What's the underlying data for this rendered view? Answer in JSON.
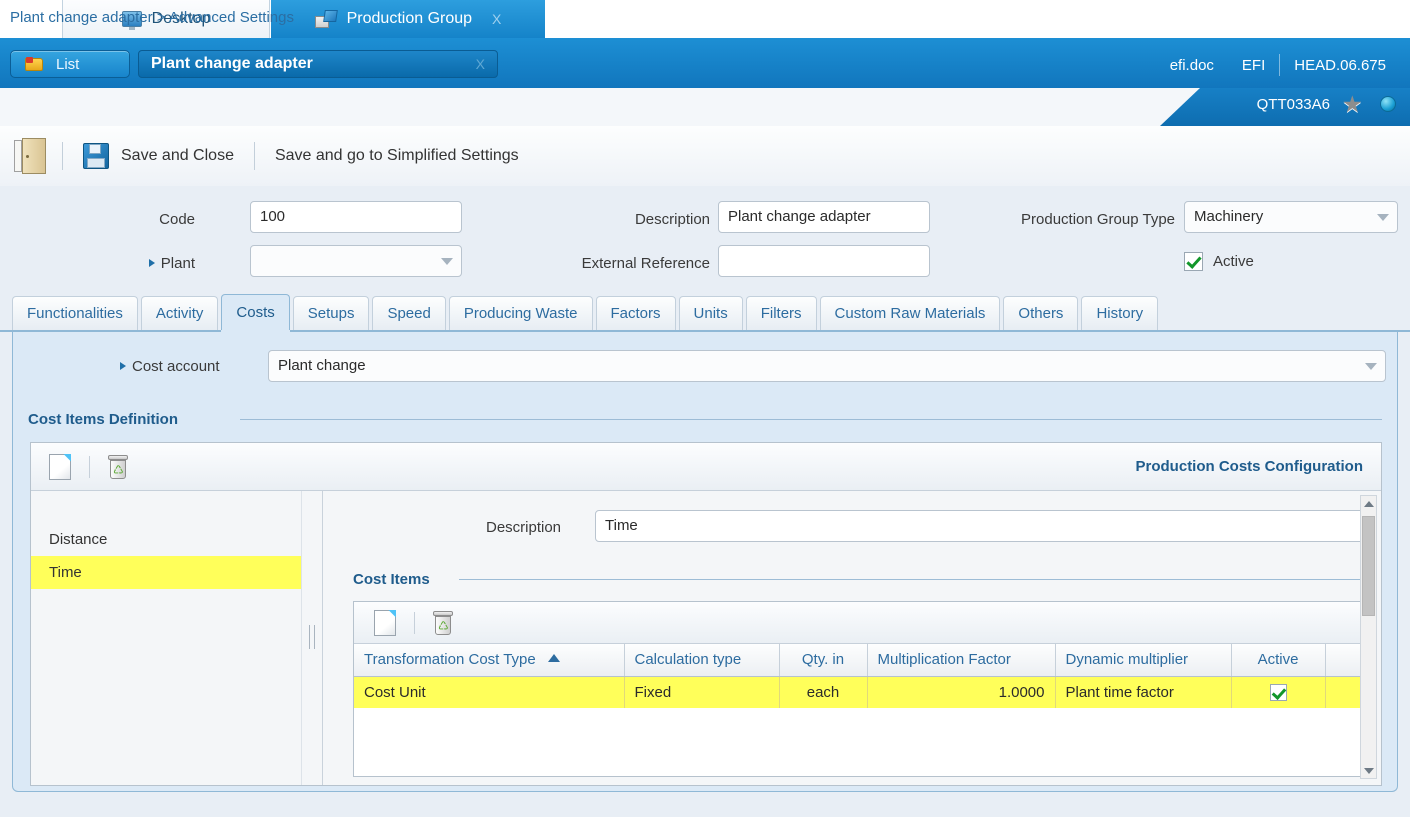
{
  "browser_tabs": [
    {
      "label": "Desktop",
      "icon": "monitor-icon",
      "active": false,
      "close": ""
    },
    {
      "label": "Production Group",
      "icon": "production-group-icon",
      "active": true,
      "close": "X"
    }
  ],
  "header": {
    "list_button": "List",
    "document_title": "Plant change adapter",
    "document_close": "X",
    "user": "efi.doc",
    "company": "EFI",
    "version": "HEAD.06.675",
    "session_code": "QTT033A6",
    "star_icon": "star-icon",
    "globe_icon": "globe-icon"
  },
  "breadcrumb": "Plant change adapter > Advanced Settings",
  "toolbar": {
    "exit_icon": "exit-door-icon",
    "save_and_close": "Save and Close",
    "save_and_simplified": "Save and go to Simplified Settings"
  },
  "form": {
    "code_label": "Code",
    "code_value": "100",
    "plant_label": "Plant",
    "plant_value": "",
    "description_label": "Description",
    "description_value": "Plant change adapter",
    "external_reference_label": "External Reference",
    "external_reference_value": "",
    "production_group_type_label": "Production Group Type",
    "production_group_type_value": "Machinery",
    "active_label": "Active",
    "active_checked": true
  },
  "tabs": [
    {
      "label": "Functionalities",
      "active": false
    },
    {
      "label": "Activity",
      "active": false
    },
    {
      "label": "Costs",
      "active": true
    },
    {
      "label": "Setups",
      "active": false
    },
    {
      "label": "Speed",
      "active": false
    },
    {
      "label": "Producing Waste",
      "active": false
    },
    {
      "label": "Factors",
      "active": false
    },
    {
      "label": "Units",
      "active": false
    },
    {
      "label": "Filters",
      "active": false
    },
    {
      "label": "Custom Raw Materials",
      "active": false
    },
    {
      "label": "Others",
      "active": false
    },
    {
      "label": "History",
      "active": false
    }
  ],
  "costs_tab": {
    "cost_account_label": "Cost account",
    "cost_account_value": "Plant change",
    "cost_items_definition_title": "Cost Items Definition",
    "card_toolbar": {
      "new_icon": "new-document-icon",
      "delete_icon": "delete-trash-icon",
      "config_link": "Production Costs Configuration"
    },
    "definition_list": [
      {
        "label": "Distance",
        "selected": false
      },
      {
        "label": "Time",
        "selected": true
      }
    ],
    "detail": {
      "description_label": "Description",
      "description_value": "Time",
      "cost_items_title": "Cost Items",
      "grid_toolbar": {
        "new_icon": "new-document-icon",
        "delete_icon": "delete-trash-icon"
      },
      "grid": {
        "columns": [
          {
            "label": "Transformation Cost Type",
            "sort": "asc",
            "align": "left"
          },
          {
            "label": "Calculation type",
            "sort": "",
            "align": "left"
          },
          {
            "label": "Qty. in",
            "sort": "",
            "align": "center"
          },
          {
            "label": "Multiplication Factor",
            "sort": "",
            "align": "right"
          },
          {
            "label": "Dynamic multiplier",
            "sort": "",
            "align": "left"
          },
          {
            "label": "Active",
            "sort": "",
            "align": "center"
          }
        ],
        "rows": [
          {
            "transformation_cost_type": "Cost Unit",
            "calculation_type": "Fixed",
            "qty_in": "each",
            "multiplication_factor": "1.0000",
            "dynamic_multiplier": "Plant time factor",
            "active": true,
            "highlighted": true
          }
        ]
      }
    }
  }
}
